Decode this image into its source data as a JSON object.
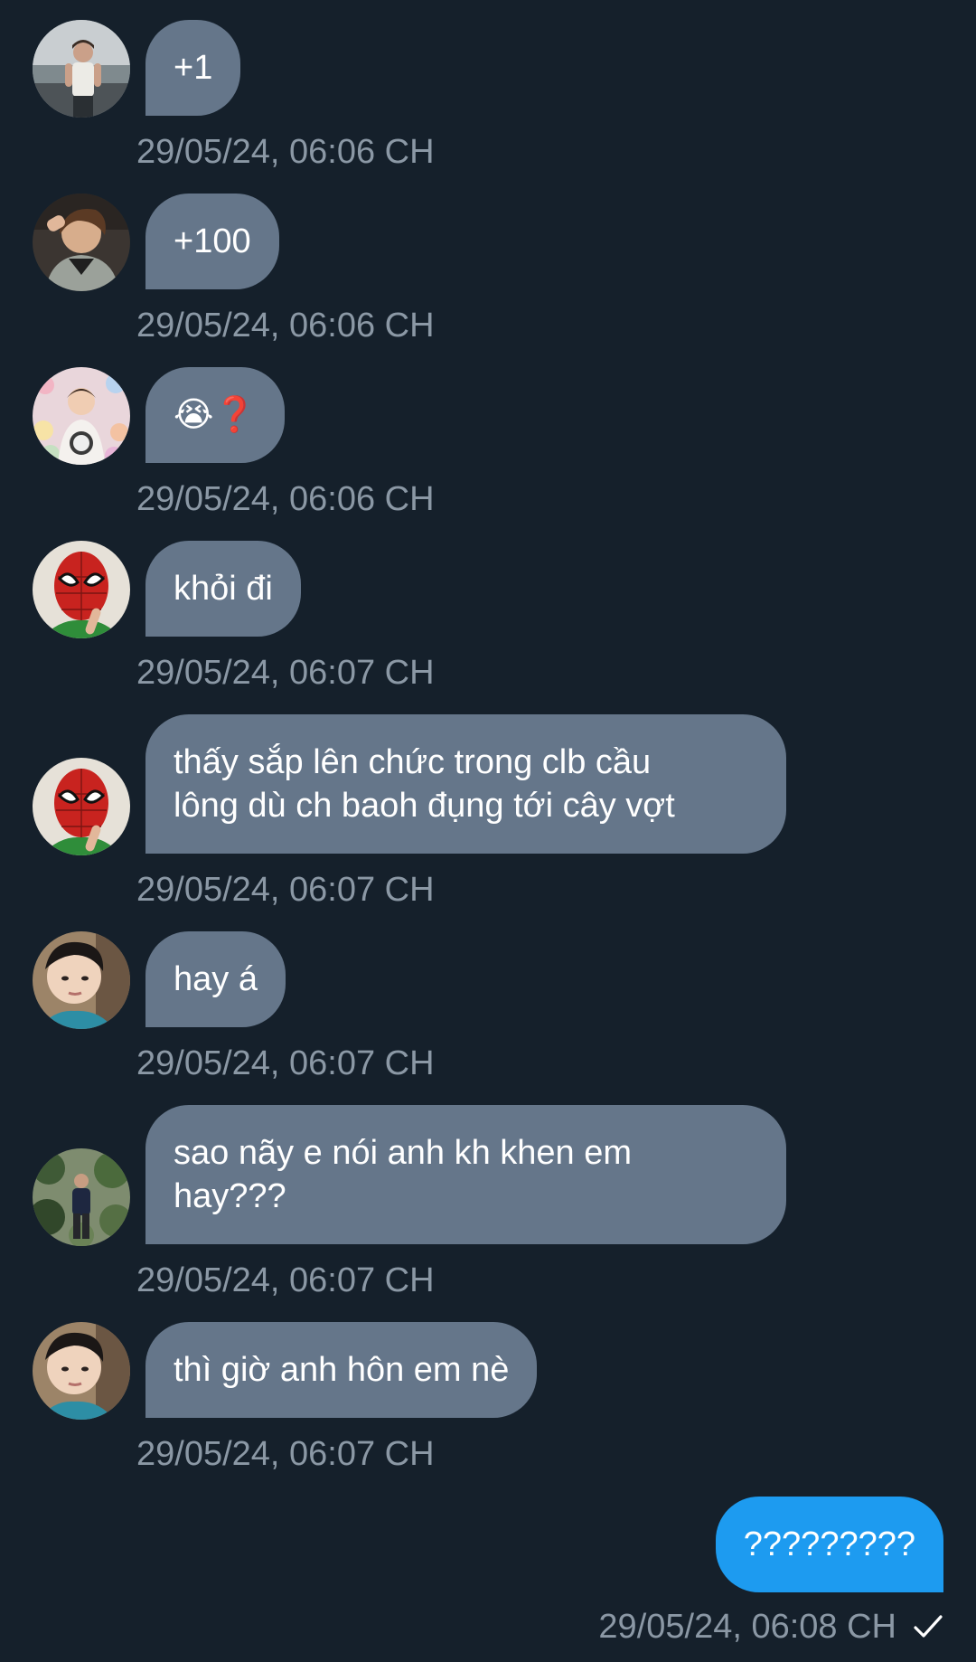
{
  "messages": [
    {
      "text": "+1",
      "timestamp": "29/05/24, 06:06 CH",
      "avatar": "person-lakeside-avatar"
    },
    {
      "text": "+100",
      "timestamp": "29/05/24, 06:06 CH",
      "avatar": "person-selfie-avatar"
    },
    {
      "text": "😭❓",
      "timestamp": "29/05/24, 06:06 CH",
      "avatar": "person-plushies-avatar"
    },
    {
      "text": "khỏi đi",
      "timestamp": "29/05/24, 06:07 CH",
      "avatar": "spiderman-mask-avatar"
    },
    {
      "text": "thấy sắp lên chức trong clb cầu\nlông dù ch baoh đụng tới cây vợt",
      "timestamp": "29/05/24, 06:07 CH",
      "avatar": "spiderman-mask-avatar"
    },
    {
      "text": "hay á",
      "timestamp": "29/05/24, 06:07 CH",
      "avatar": "person-portrait-avatar"
    },
    {
      "text": "sao nãy e nói anh kh khen em\nhay???",
      "timestamp": "29/05/24, 06:07 CH",
      "avatar": "person-plants-avatar"
    },
    {
      "text": "thì giờ anh hôn em nè",
      "timestamp": "29/05/24, 06:07 CH",
      "avatar": "person-portrait-avatar"
    }
  ],
  "own_message": {
    "text": "?????????",
    "timestamp": "29/05/24, 06:08 CH",
    "status_icon": "check-icon"
  },
  "colors": {
    "background": "#15202b",
    "received_bubble": "#65768a",
    "sent_bubble": "#1d9bf0",
    "timestamp_text": "#8b98a5"
  }
}
